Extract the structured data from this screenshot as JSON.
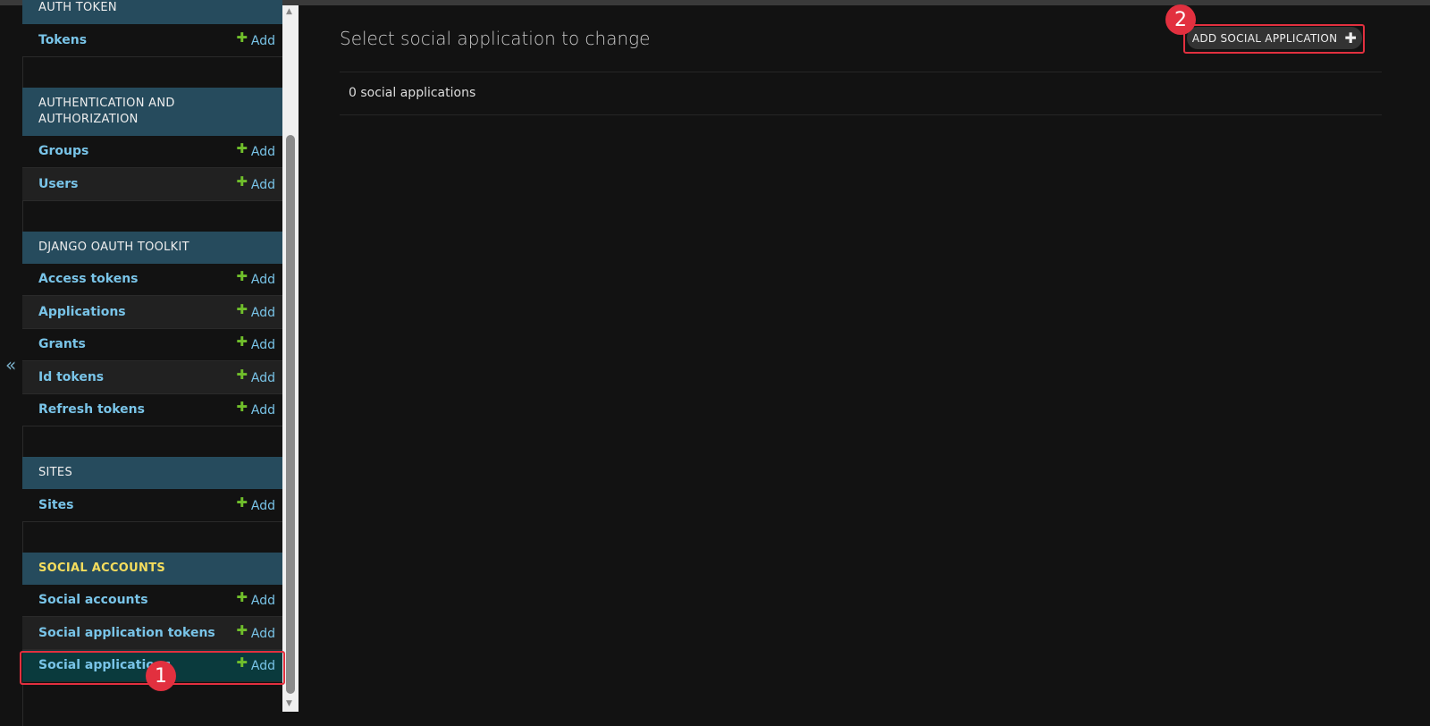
{
  "sidebar": {
    "collapse_icon": "«",
    "add_label": "Add",
    "sections": [
      {
        "title": "AUTH TOKEN",
        "items": [
          "Tokens"
        ]
      },
      {
        "title": "AUTHENTICATION AND AUTHORIZATION",
        "items": [
          "Groups",
          "Users"
        ]
      },
      {
        "title": "DJANGO OAUTH TOOLKIT",
        "items": [
          "Access tokens",
          "Applications",
          "Grants",
          "Id tokens",
          "Refresh tokens"
        ]
      },
      {
        "title": "SITES",
        "items": [
          "Sites"
        ]
      },
      {
        "title": "SOCIAL ACCOUNTS",
        "items": [
          "Social accounts",
          "Social application tokens",
          "Social applications"
        ]
      }
    ],
    "selected_section": "SOCIAL ACCOUNTS",
    "selected_item": "Social applications"
  },
  "main": {
    "title": "Select social application to change",
    "add_button": "ADD SOCIAL APPLICATION",
    "count": "0 social applications"
  },
  "annotations": [
    "1",
    "2"
  ],
  "colors": {
    "header": "#264b5d",
    "link": "#79c4e8",
    "add_plus": "#70bf2b",
    "highlight": "#e2303f",
    "selected_header_text": "#f5dd5d"
  }
}
